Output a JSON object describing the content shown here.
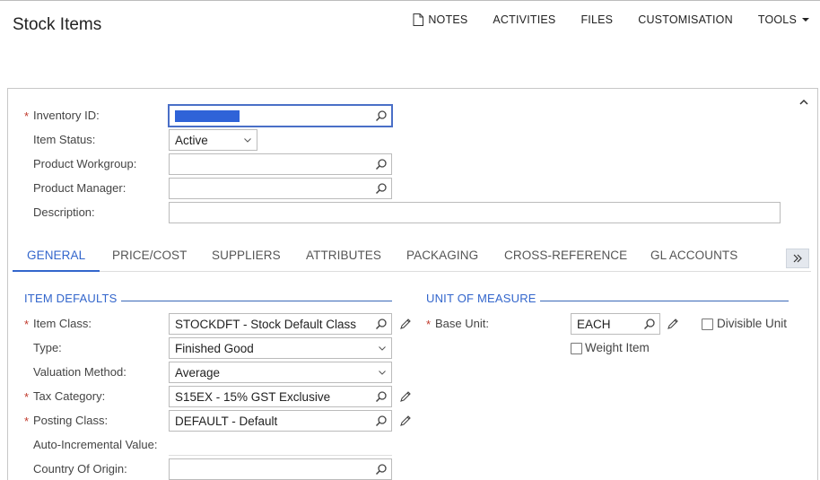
{
  "page": {
    "title": "Stock Items"
  },
  "toolbar": {
    "notes": "NOTES",
    "activities": "ACTIVITIES",
    "files": "FILES",
    "customisation": "CUSTOMISATION",
    "tools": "TOOLS"
  },
  "header_form": {
    "inventory_id": {
      "label": "Inventory ID:",
      "value": "",
      "required": "*"
    },
    "item_status": {
      "label": "Item Status:",
      "value": "Active"
    },
    "product_workgroup": {
      "label": "Product Workgroup:",
      "value": ""
    },
    "product_manager": {
      "label": "Product Manager:",
      "value": ""
    },
    "description": {
      "label": "Description:",
      "value": ""
    }
  },
  "tabs": [
    {
      "label": "GENERAL"
    },
    {
      "label": "PRICE/COST"
    },
    {
      "label": "SUPPLIERS"
    },
    {
      "label": "ATTRIBUTES"
    },
    {
      "label": "PACKAGING"
    },
    {
      "label": "CROSS-REFERENCE"
    },
    {
      "label": "GL ACCOUNTS"
    }
  ],
  "item_defaults": {
    "title": "ITEM DEFAULTS",
    "item_class": {
      "label": "Item Class:",
      "value": "STOCKDFT - Stock Default Class",
      "required": "*"
    },
    "type": {
      "label": "Type:",
      "value": "Finished Good"
    },
    "valuation_method": {
      "label": "Valuation Method:",
      "value": "Average"
    },
    "tax_category": {
      "label": "Tax Category:",
      "value": "S15EX - 15% GST Exclusive",
      "required": "*"
    },
    "posting_class": {
      "label": "Posting Class:",
      "value": "DEFAULT - Default",
      "required": "*"
    },
    "auto_incremental": {
      "label": "Auto-Incremental Value:"
    },
    "country_of_origin": {
      "label": "Country Of Origin:",
      "value": ""
    }
  },
  "unit_of_measure": {
    "title": "UNIT OF MEASURE",
    "base_unit": {
      "label": "Base Unit:",
      "value": "EACH",
      "required": "*"
    },
    "divisible_unit": {
      "label": "Divisible Unit",
      "checked": false
    },
    "weight_item": {
      "label": "Weight Item",
      "checked": false
    }
  },
  "colors": {
    "accent": "#3366cc",
    "required": "#c0392b",
    "selection": "#2f63d8"
  }
}
